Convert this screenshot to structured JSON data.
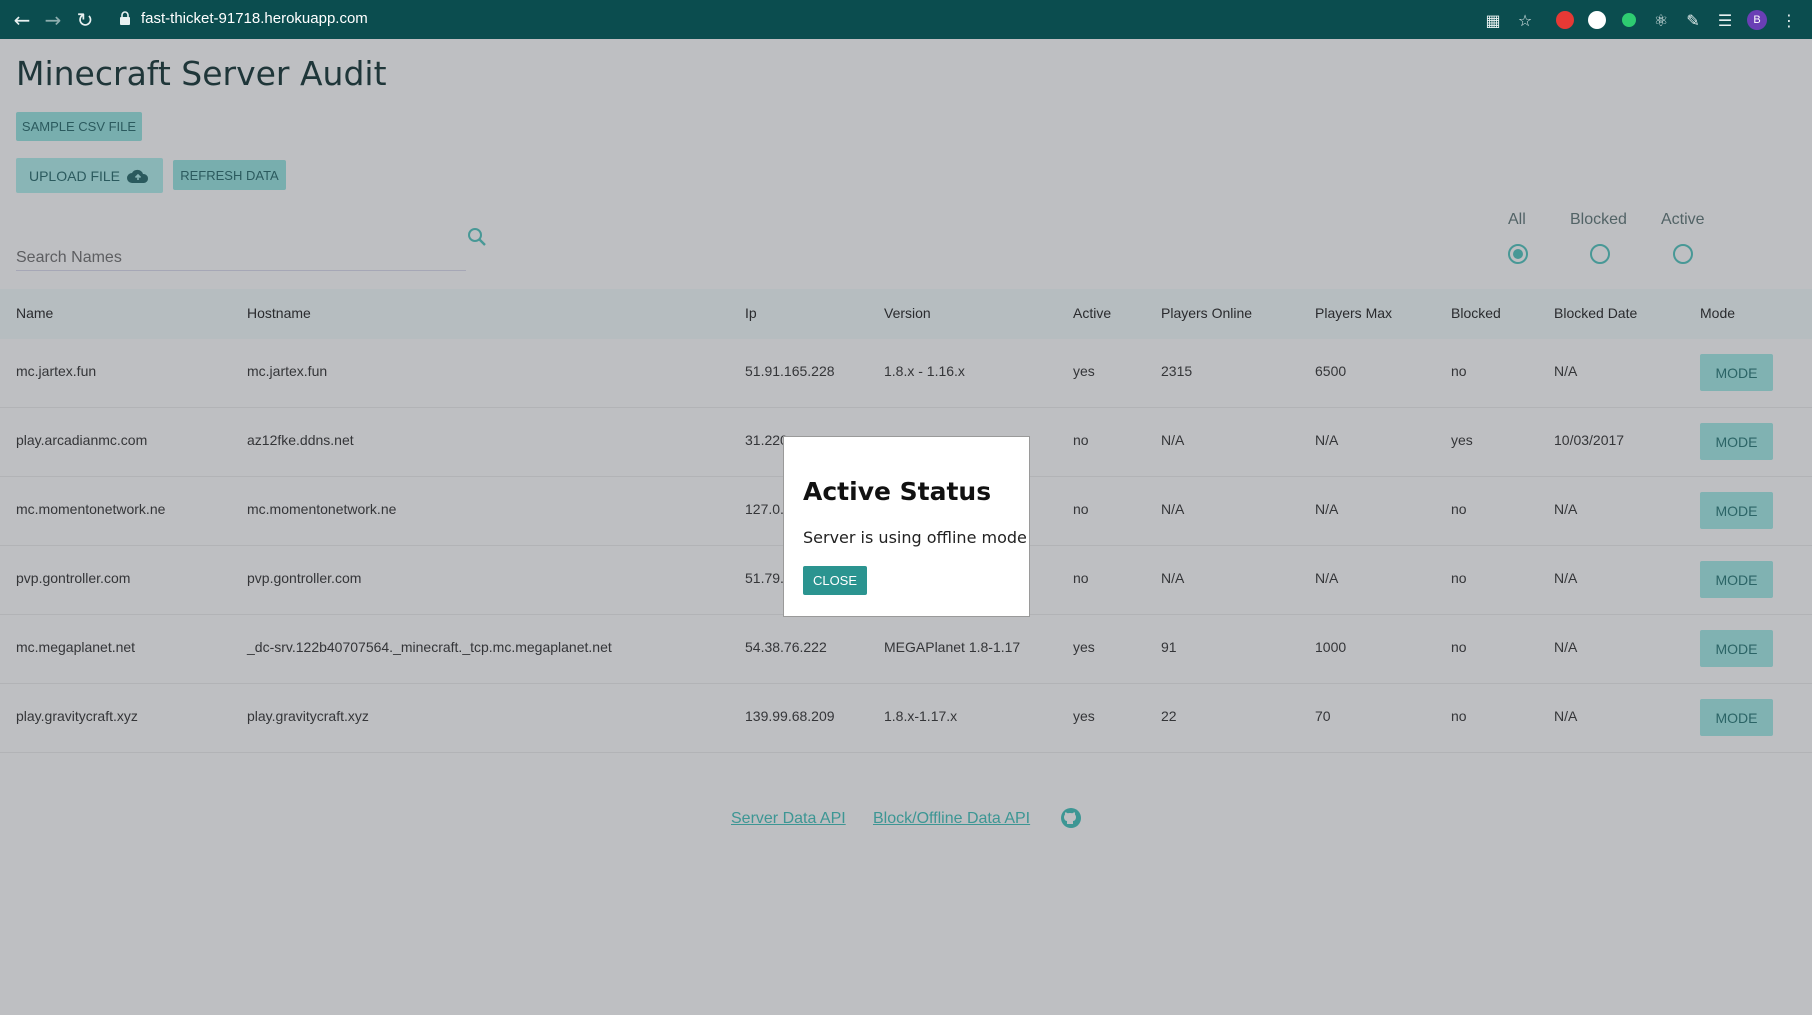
{
  "browser": {
    "url": "fast-thicket-91718.herokuapp.com",
    "profile_initial": "B"
  },
  "header": {
    "title": "Minecraft Server Audit",
    "sample_csv_label": "SAMPLE CSV FILE",
    "upload_label": "UPLOAD FILE",
    "refresh_label": "REFRESH DATA"
  },
  "search": {
    "placeholder": "Search Names"
  },
  "filters": [
    {
      "label": "All",
      "checked": true
    },
    {
      "label": "Blocked",
      "checked": false
    },
    {
      "label": "Active",
      "checked": false
    }
  ],
  "table": {
    "columns": [
      "Name",
      "Hostname",
      "Ip",
      "Version",
      "Active",
      "Players Online",
      "Players Max",
      "Blocked",
      "Blocked Date",
      "Mode"
    ],
    "rows": [
      {
        "name": "mc.jartex.fun",
        "hostname": "mc.jartex.fun",
        "ip": "51.91.165.228",
        "version": "1.8.x - 1.16.x",
        "active": "yes",
        "players_online": "2315",
        "players_max": "6500",
        "blocked": "no",
        "blocked_date": "N/A",
        "mode": "MODE"
      },
      {
        "name": "play.arcadianmc.com",
        "hostname": "az12fke.ddns.net",
        "ip": "31.220",
        "version": "",
        "active": "no",
        "players_online": "N/A",
        "players_max": "N/A",
        "blocked": "yes",
        "blocked_date": "10/03/2017",
        "mode": "MODE"
      },
      {
        "name": "mc.momentonetwork.ne",
        "hostname": "mc.momentonetwork.ne",
        "ip": "127.0.",
        "version": "",
        "active": "no",
        "players_online": "N/A",
        "players_max": "N/A",
        "blocked": "no",
        "blocked_date": "N/A",
        "mode": "MODE"
      },
      {
        "name": "pvp.gontroller.com",
        "hostname": "pvp.gontroller.com",
        "ip": "51.79.1",
        "version": "",
        "active": "no",
        "players_online": "N/A",
        "players_max": "N/A",
        "blocked": "no",
        "blocked_date": "N/A",
        "mode": "MODE"
      },
      {
        "name": "mc.megaplanet.net",
        "hostname": "_dc-srv.122b40707564._minecraft._tcp.mc.megaplanet.net",
        "ip": "54.38.76.222",
        "version": "MEGAPlanet 1.8-1.17",
        "active": "yes",
        "players_online": "91",
        "players_max": "1000",
        "blocked": "no",
        "blocked_date": "N/A",
        "mode": "MODE"
      },
      {
        "name": "play.gravitycraft.xyz",
        "hostname": "play.gravitycraft.xyz",
        "ip": "139.99.68.209",
        "version": "1.8.x-1.17.x",
        "active": "yes",
        "players_online": "22",
        "players_max": "70",
        "blocked": "no",
        "blocked_date": "N/A",
        "mode": "MODE"
      }
    ]
  },
  "footer": {
    "server_api_label": "Server Data API",
    "block_api_label": "Block/Offline Data API"
  },
  "modal": {
    "title": "Active Status",
    "body": "Server is using offline mode",
    "close_label": "CLOSE"
  }
}
